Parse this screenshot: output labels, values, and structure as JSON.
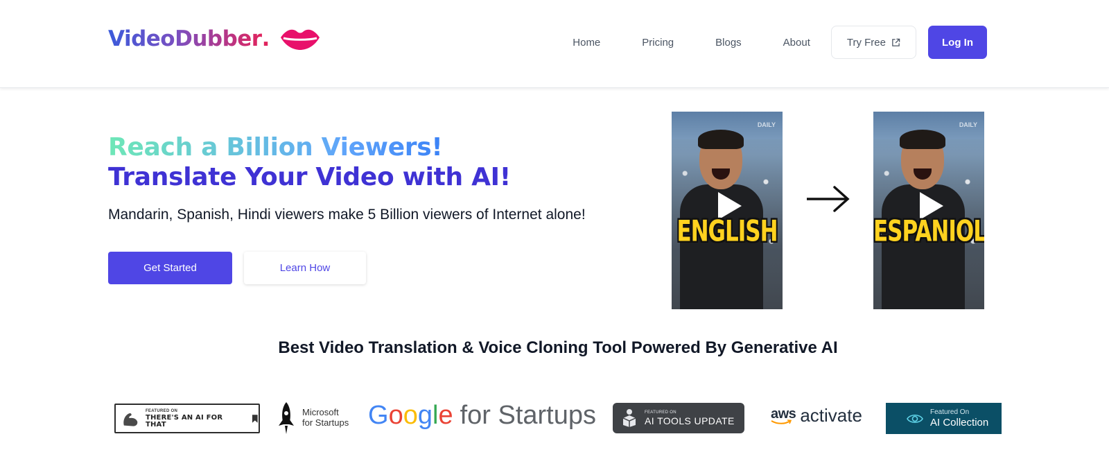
{
  "header": {
    "logo_text": "VideoDubber",
    "logo_dot": ".",
    "logo_icon": "lips-icon",
    "nav": [
      "Home",
      "Pricing",
      "Blogs",
      "About"
    ],
    "try_free_label": "Try Free",
    "login_label": "Log In"
  },
  "hero": {
    "headline_line1": "Reach a Billion Viewers!",
    "headline_line2": "Translate Your Video with AI!",
    "subtitle": "Mandarin, Spanish, Hindi viewers make 5 Billion viewers of Internet alone!",
    "primary_button": "Get Started",
    "secondary_button": "Learn How",
    "video_source": {
      "caption": "ENGLISH",
      "watermark": "DAILY"
    },
    "video_target": {
      "caption": "ESPANIOL",
      "watermark": "DAILY"
    }
  },
  "tagline": "Best Video Translation & Voice Cloning Tool Powered By Generative AI",
  "badges": {
    "aiforthat": {
      "small": "FEATURED ON",
      "big": "THERE'S AN AI FOR THAT"
    },
    "microsoft": {
      "line1": "Microsoft",
      "line2": "for Startups"
    },
    "google": {
      "suffix": "for Startups"
    },
    "aitools": {
      "small": "FEATURED ON",
      "big": "AI TOOLS UPDATE"
    },
    "aws": {
      "mark": "aws",
      "word": "activate"
    },
    "aicollection": {
      "small": "Featured On",
      "big": "AI Collection"
    }
  },
  "colors": {
    "primary": "#4f46e5",
    "headline_dark": "#3f32d4",
    "logo_pink": "#e0245e",
    "caption_yellow": "#ffd21f"
  }
}
